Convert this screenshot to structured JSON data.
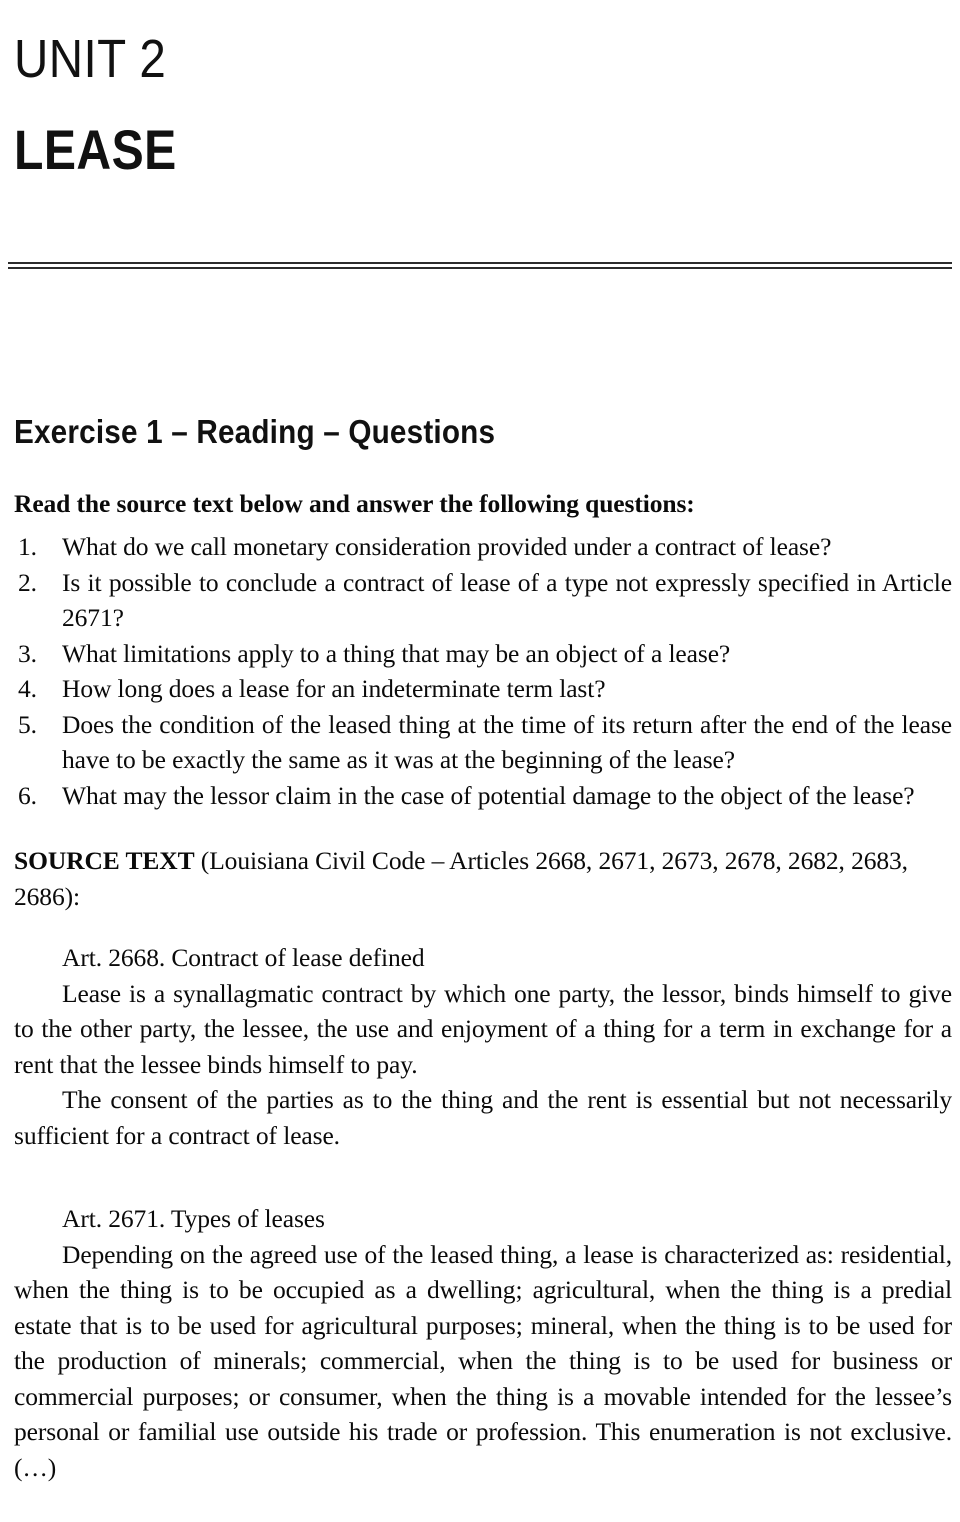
{
  "unit": {
    "number_label": "UNIT 2",
    "name_label": "LEASE"
  },
  "exercise": {
    "heading": "Exercise 1 – Reading – Questions",
    "instruction": "Read the source text below and answer the following questions:",
    "questions": [
      {
        "number": "1.",
        "text": "What do we call monetary consideration provided under a contract of lease?"
      },
      {
        "number": "2.",
        "text": "Is it possible to conclude a contract of lease of a type not expressly specified in Article 2671?"
      },
      {
        "number": "3.",
        "text": "What limitations apply to a thing that may be an object of a lease?"
      },
      {
        "number": "4.",
        "text": "How long does a lease for an indeterminate term last?"
      },
      {
        "number": "5.",
        "text": "Does the condition of the leased thing at the time of its return after the end of the lease have to be exactly the same as it was at the beginning of the lease?"
      },
      {
        "number": "6.",
        "text": "What may the lessor claim in the case of potential damage to the object of the lease?"
      }
    ]
  },
  "source": {
    "label_bold": "SOURCE TEXT",
    "label_rest": " (Louisiana Civil Code – Articles 2668, 2671, 2673, 2678, 2682, 2683, 2686):",
    "articles": [
      {
        "title": "Art. 2668. Contract of lease defined",
        "paragraphs": [
          "Lease is a synallagmatic contract by which one party, the lessor, binds himself to give to the other party, the lessee, the use and enjoyment of a thing for a term in exchange for a rent that the lessee binds himself to pay.",
          "The consent of the parties as to the thing and the rent is essential but not necessarily sufficient for a contract of lease."
        ]
      },
      {
        "title": "Art. 2671. Types of leases",
        "paragraphs": [
          "Depending on the agreed use of the leased thing, a lease is characterized as: residential, when the thing is to be occupied as a dwelling; agricultural, when the thing is a predial estate that is to be used for agricultural purposes; mineral, when the thing is to be used for the production of minerals; commercial, when the thing is to be used for business or commercial purposes; or consumer, when the thing is a movable intended for the lessee’s personal or familial use outside his trade or profession. This enumeration is not exclusive. (…)"
        ]
      }
    ]
  },
  "colors": {
    "text": "#0a0a0a",
    "rule": "#2c2c2c",
    "background": "#ffffff"
  }
}
